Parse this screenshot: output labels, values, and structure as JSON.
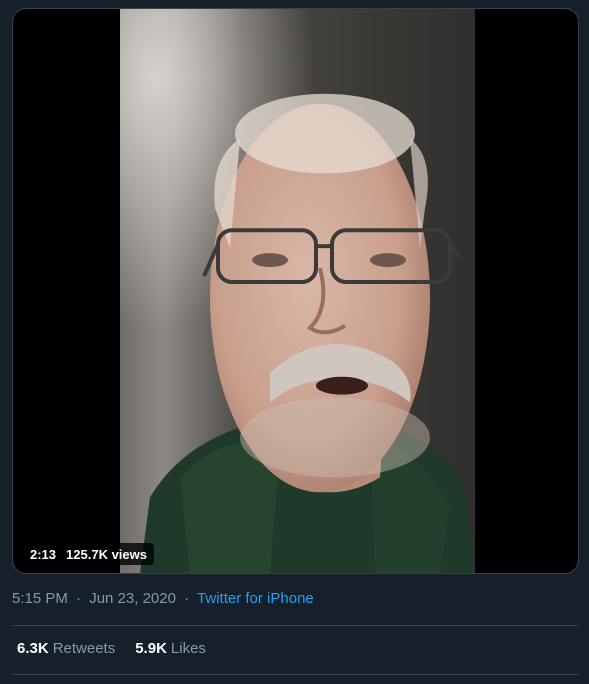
{
  "video": {
    "duration": "2:13",
    "views": "125.7K views"
  },
  "tweet_meta": {
    "time": "5:15 PM",
    "separator": "·",
    "date": "Jun 23, 2020",
    "source": "Twitter for iPhone"
  },
  "stats": {
    "retweets_count": "6.3K",
    "retweets_label": "Retweets",
    "likes_count": "5.9K",
    "likes_label": "Likes"
  },
  "colors": {
    "background": "#15202b",
    "muted_text": "#8899a6",
    "link": "#1da1f2",
    "border": "#38444d"
  }
}
